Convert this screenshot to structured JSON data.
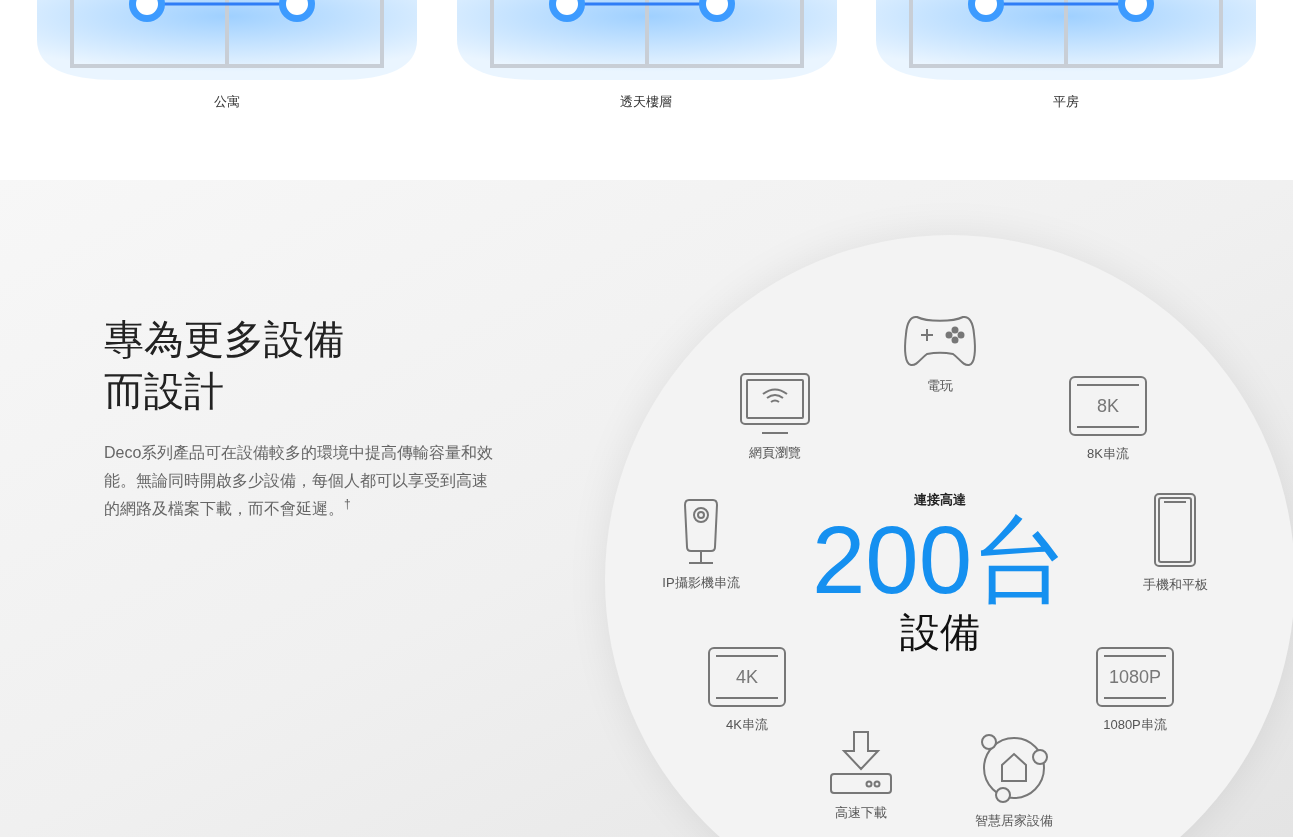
{
  "home_types": [
    {
      "caption": "公寓"
    },
    {
      "caption": "透天樓層"
    },
    {
      "caption": "平房"
    }
  ],
  "section": {
    "heading_lines": [
      "專為更多設備",
      "而設計"
    ],
    "paragraph": "Deco系列產品可在設備較多的環境中提高傳輸容量和效能。無論同時開啟多少設備，每個人都可以享受到高速的網路及檔案下載，而不會延遲。$^{†}$",
    "center": {
      "caption": "連接高達",
      "count": "200台",
      "unit": "設備"
    },
    "devices": [
      {
        "kind": "gamepad",
        "label": "電玩"
      },
      {
        "kind": "monitor",
        "label": "網頁瀏覽"
      },
      {
        "kind": "screen",
        "screen_text": "8K",
        "label": "8K串流"
      },
      {
        "kind": "camera",
        "label": "IP攝影機串流"
      },
      {
        "kind": "phone",
        "label": "手機和平板"
      },
      {
        "kind": "screen",
        "screen_text": "4K",
        "label": "4K串流"
      },
      {
        "kind": "screen",
        "screen_text": "1080P",
        "label": "1080P串流"
      },
      {
        "kind": "download",
        "label": "高速下載"
      },
      {
        "kind": "smarthome",
        "label": "智慧居家設備"
      }
    ]
  }
}
